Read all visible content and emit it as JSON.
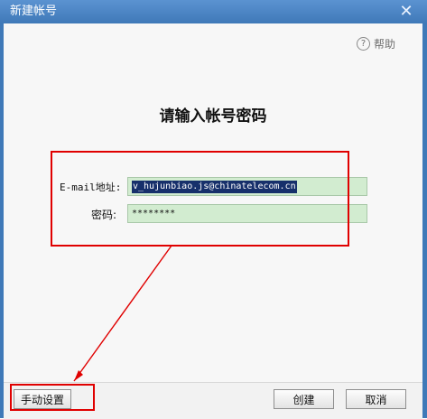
{
  "window": {
    "title": "新建帐号",
    "close_label": "✕"
  },
  "help": {
    "icon": "?",
    "label": "帮助"
  },
  "heading": "请输入帐号密码",
  "fields": {
    "email_label": "E-mail地址:",
    "email_value": "v_hujunbiao.js@chinatelecom.cn",
    "password_label": "密码:",
    "password_value": "********"
  },
  "buttons": {
    "manual": "手动设置",
    "create": "创建",
    "cancel": "取消"
  },
  "colors": {
    "title_bar": "#3f79b8",
    "field_bg": "#d2ecd0",
    "annotation_red": "#e00000",
    "selection": "#17306b"
  }
}
